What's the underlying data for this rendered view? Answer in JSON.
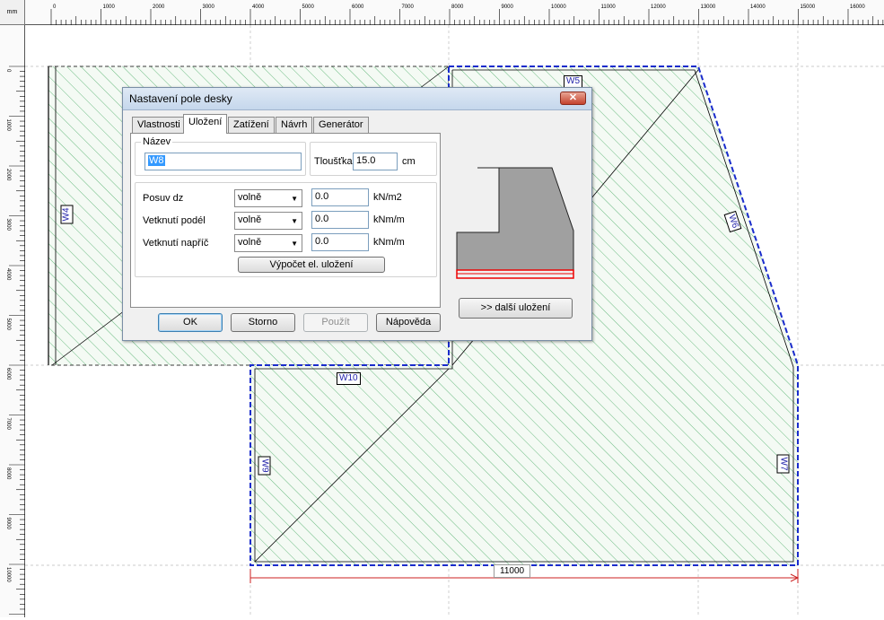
{
  "ruler": {
    "unit": "mm",
    "h_labels": [
      "0",
      "1000",
      "2000",
      "3000",
      "4000",
      "5000",
      "6000",
      "7000",
      "8000",
      "9000",
      "10000",
      "11000",
      "12000",
      "13000",
      "14000",
      "15000",
      "16000"
    ],
    "v_labels": [
      "0",
      "1000",
      "2000",
      "3000",
      "4000",
      "5000",
      "6000",
      "7000",
      "8000",
      "9000",
      "10000"
    ]
  },
  "drawing": {
    "walls": [
      "W4",
      "W5",
      "W6",
      "W7",
      "W9",
      "W10"
    ],
    "dimension": "11000",
    "colors": {
      "hatch": "#2e9e4e",
      "slab_fill": "#eef6ee",
      "wall_border": "#1a2ccc",
      "dimension": "#cc2222"
    }
  },
  "dialog": {
    "title": "Nastavení pole desky",
    "close_icon": "close-icon",
    "tabs": [
      {
        "label": "Vlastnosti"
      },
      {
        "label": "Uložení"
      },
      {
        "label": "Zatížení"
      },
      {
        "label": "Návrh"
      },
      {
        "label": "Generátor"
      }
    ],
    "name_group": {
      "legend": "Název",
      "value": "W8"
    },
    "thickness": {
      "label": "Tloušťka",
      "value": "15.0",
      "unit": "cm"
    },
    "supports": [
      {
        "label": "Posuv dz",
        "option": "volně",
        "value": "0.0",
        "unit": "kN/m2"
      },
      {
        "label": "Vetknutí podél",
        "option": "volně",
        "value": "0.0",
        "unit": "kNm/m"
      },
      {
        "label": "Vetknutí napříč",
        "option": "volně",
        "value": "0.0",
        "unit": "kNm/m"
      }
    ],
    "calc_button": "Výpočet el. uložení",
    "more_button": ">> další uložení",
    "buttons": {
      "ok": "OK",
      "cancel": "Storno",
      "apply": "Použít",
      "help": "Nápověda"
    }
  }
}
